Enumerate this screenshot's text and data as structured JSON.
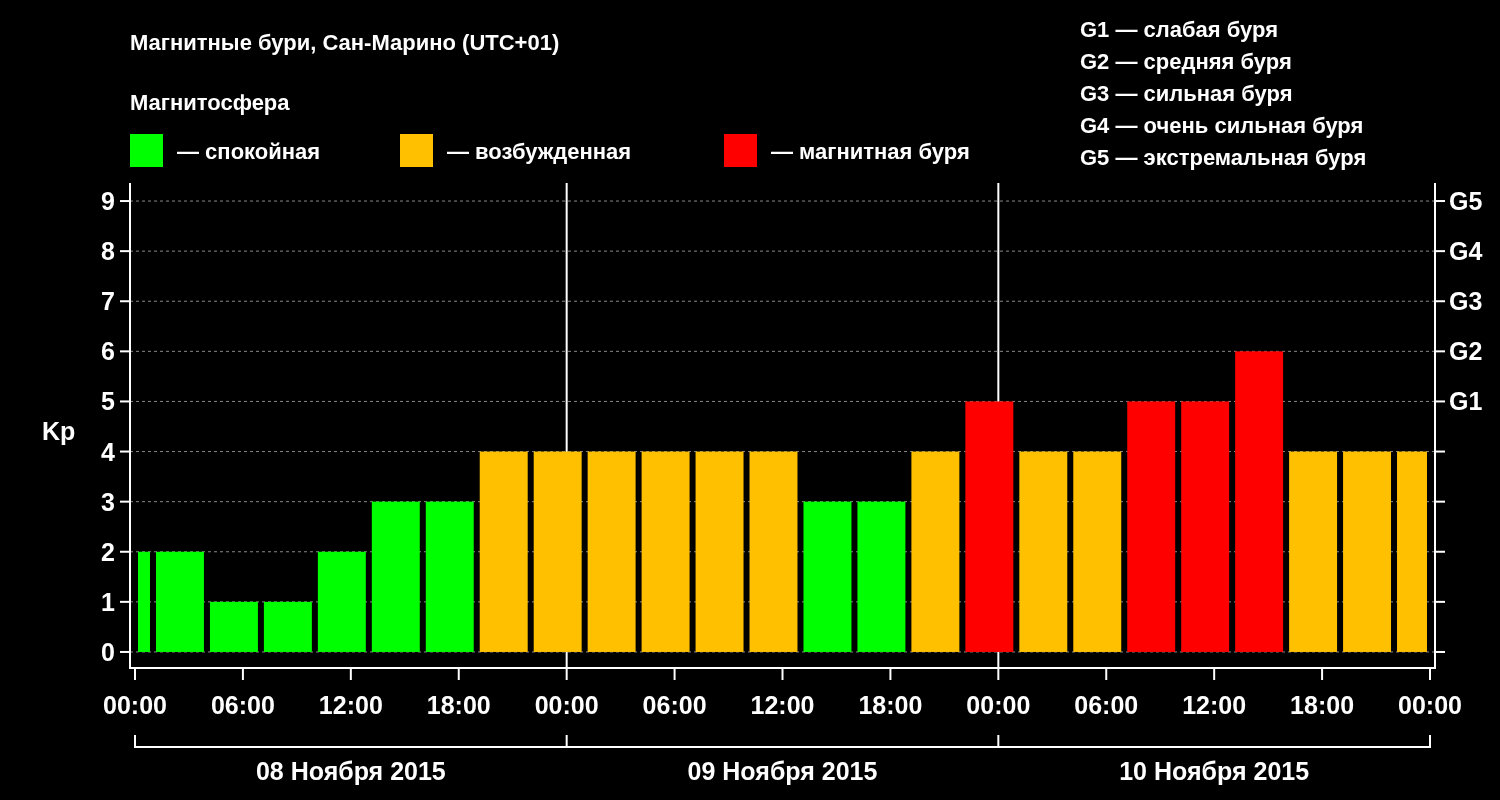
{
  "title": "Магнитные бури, Сан-Марино (UTC+01)",
  "legend": {
    "title": "Магнитосфера"
  },
  "storm_scale": [
    "G1 — слабая буря",
    "G2 — средняя буря",
    "G3 — сильная буря",
    "G4 — очень сильная буря",
    "G5 — экстремальная буря"
  ],
  "chart_data": {
    "type": "bar",
    "ylabel": "Kp",
    "grid": true,
    "x": [
      "2015-11-08T00:30",
      "2015-11-08T02:30",
      "2015-11-08T05:30",
      "2015-11-08T08:30",
      "2015-11-08T11:30",
      "2015-11-08T14:30",
      "2015-11-08T17:30",
      "2015-11-08T20:30",
      "2015-11-08T23:30",
      "2015-11-09T02:30",
      "2015-11-09T05:30",
      "2015-11-09T08:30",
      "2015-11-09T11:30",
      "2015-11-09T14:30",
      "2015-11-09T17:30",
      "2015-11-09T20:30",
      "2015-11-09T23:30",
      "2015-11-10T02:30",
      "2015-11-10T05:30",
      "2015-11-10T08:30",
      "2015-11-10T11:30",
      "2015-11-10T14:30",
      "2015-11-10T17:30",
      "2015-11-10T20:30",
      "2015-11-10T23:00"
    ],
    "xlim": [
      "2015-11-08T00:00",
      "2015-11-11T00:00"
    ],
    "ylim": [
      -0.32,
      9.36
    ],
    "series": [
      {
        "name": "— спокойная",
        "color": "#00ff00",
        "values": [
          2,
          2,
          1,
          1,
          2,
          3,
          3,
          null,
          null,
          null,
          null,
          null,
          null,
          3,
          3,
          null,
          null,
          null,
          null,
          null,
          null,
          null,
          null,
          null,
          null
        ]
      },
      {
        "name": "— возбужденная",
        "color": "#ffc000",
        "values": [
          null,
          null,
          null,
          null,
          null,
          null,
          null,
          4,
          4,
          4,
          4,
          4,
          4,
          null,
          null,
          4,
          null,
          4,
          4,
          null,
          null,
          null,
          4,
          4,
          4
        ]
      },
      {
        "name": "— магнитная буря",
        "color": "#ff0000",
        "values": [
          null,
          null,
          null,
          null,
          null,
          null,
          null,
          null,
          null,
          null,
          null,
          null,
          null,
          null,
          null,
          null,
          5,
          null,
          null,
          5,
          5,
          6,
          null,
          null,
          null
        ]
      }
    ],
    "xticks": [
      {
        "value": "2015-11-08T00:00",
        "label": "00:00"
      },
      {
        "value": "2015-11-08T06:00",
        "label": "06:00"
      },
      {
        "value": "2015-11-08T12:00",
        "label": "12:00"
      },
      {
        "value": "2015-11-08T18:00",
        "label": "18:00"
      },
      {
        "value": "2015-11-09T00:00",
        "label": "00:00"
      },
      {
        "value": "2015-11-09T06:00",
        "label": "06:00"
      },
      {
        "value": "2015-11-09T12:00",
        "label": "12:00"
      },
      {
        "value": "2015-11-09T18:00",
        "label": "18:00"
      },
      {
        "value": "2015-11-10T00:00",
        "label": "00:00"
      },
      {
        "value": "2015-11-10T06:00",
        "label": "06:00"
      },
      {
        "value": "2015-11-10T12:00",
        "label": "12:00"
      },
      {
        "value": "2015-11-10T18:00",
        "label": "18:00"
      },
      {
        "value": "2015-11-11T00:00",
        "label": "00:00"
      }
    ],
    "yticks": [
      0,
      1,
      2,
      3,
      4,
      5,
      6,
      7,
      8,
      9
    ],
    "annotations": [
      "G1",
      "G2",
      "G3",
      "G4",
      "G5"
    ]
  },
  "days": [
    "08 Ноября 2015",
    "09 Ноября 2015",
    "10 Ноября 2015"
  ]
}
